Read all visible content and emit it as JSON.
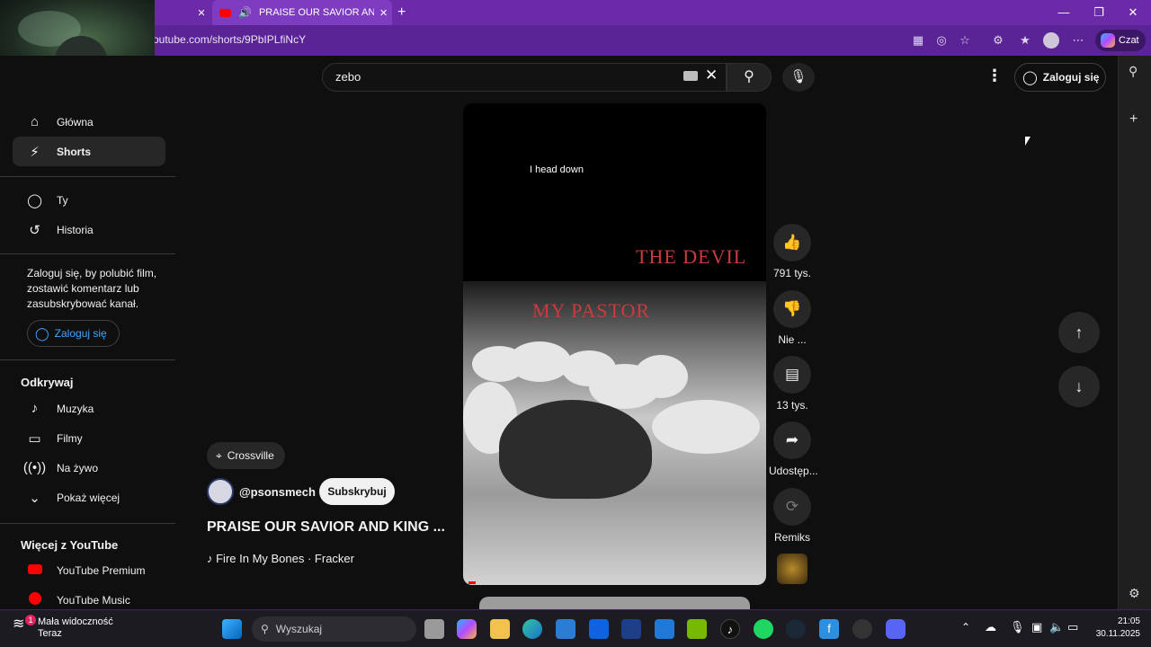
{
  "browser": {
    "tab_active_title": "PRAISE OUR SAVIOR AND KI",
    "url": "outube.com/shorts/9PbIPLfiNcY",
    "copilot_label": "Czat"
  },
  "youtube": {
    "search_value": "zebo",
    "login_label": "Zaloguj się",
    "sidebar": {
      "items": [
        {
          "label": "Główna"
        },
        {
          "label": "Shorts"
        },
        {
          "label": "Ty"
        },
        {
          "label": "Historia"
        }
      ],
      "signin_prompt": "Zaloguj się, by polubić film, zostawić komentarz lub zasubskrybować kanał.",
      "signin_button": "Zaloguj się",
      "explore_heading": "Odkrywaj",
      "explore": [
        {
          "label": "Muzyka"
        },
        {
          "label": "Filmy"
        },
        {
          "label": "Na żywo"
        },
        {
          "label": "Pokaż więcej"
        }
      ],
      "more_heading": "Więcej z YouTube",
      "more": [
        {
          "label": "YouTube Premium"
        },
        {
          "label": "YouTube Music"
        }
      ]
    },
    "video": {
      "caption_top": "I head down",
      "caption_devil": "THE DEVIL",
      "caption_pastor": "MY PASTOR"
    },
    "actions": {
      "likes": "791 tys.",
      "dislike": "Nie ...",
      "comments": "13 tys.",
      "share": "Udostęp...",
      "remix": "Remiks"
    },
    "location": "Crossville",
    "channel": "@psonsmech",
    "subscribe": "Subskrybuj",
    "title": "PRAISE OUR SAVIOR AND KING ...",
    "music": "♪ Fire In My Bones · Fracker"
  },
  "taskbar": {
    "weather_title": "Mała widoczność",
    "weather_sub": "Teraz",
    "search_placeholder": "Wyszukaj",
    "time": "21:05",
    "date": "30.11.2025",
    "notif_count": "1"
  },
  "colors": {
    "browser_purple": "#6b2aa8",
    "yt_bg": "#0f0f0f",
    "accent_blue": "#3ea6ff",
    "caption_red": "#c93b3e"
  }
}
